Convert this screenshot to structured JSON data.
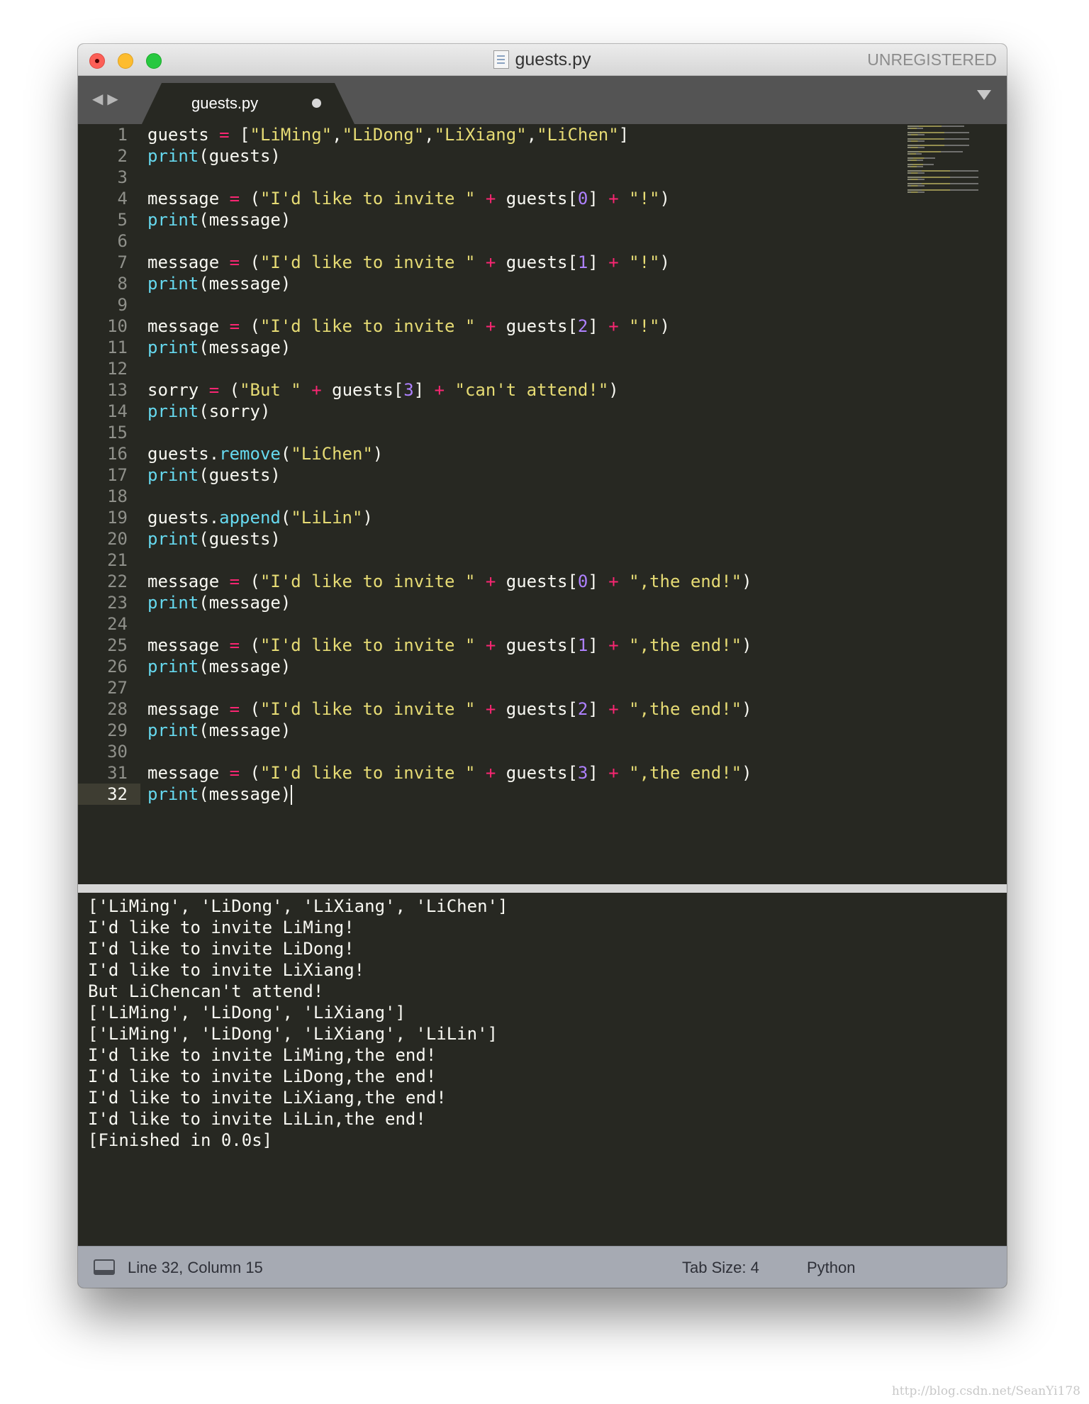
{
  "window": {
    "title": "guests.py",
    "registration": "UNREGISTERED"
  },
  "tab": {
    "label": "guests.py"
  },
  "editor": {
    "current_line": "32",
    "lines": [
      {
        "num": "1",
        "tokens": [
          {
            "t": "guests ",
            "c": ""
          },
          {
            "t": "=",
            "c": "op"
          },
          {
            "t": " [",
            "c": ""
          },
          {
            "t": "\"LiMing\"",
            "c": "str"
          },
          {
            "t": ",",
            "c": ""
          },
          {
            "t": "\"LiDong\"",
            "c": "str"
          },
          {
            "t": ",",
            "c": ""
          },
          {
            "t": "\"LiXiang\"",
            "c": "str"
          },
          {
            "t": ",",
            "c": ""
          },
          {
            "t": "\"LiChen\"",
            "c": "str"
          },
          {
            "t": "]",
            "c": ""
          }
        ]
      },
      {
        "num": "2",
        "tokens": [
          {
            "t": "print",
            "c": "fn"
          },
          {
            "t": "(guests)",
            "c": ""
          }
        ]
      },
      {
        "num": "3",
        "tokens": []
      },
      {
        "num": "4",
        "tokens": [
          {
            "t": "message ",
            "c": ""
          },
          {
            "t": "=",
            "c": "op"
          },
          {
            "t": " (",
            "c": ""
          },
          {
            "t": "\"I'd like to invite \"",
            "c": "str"
          },
          {
            "t": " ",
            "c": ""
          },
          {
            "t": "+",
            "c": "op"
          },
          {
            "t": " guests[",
            "c": ""
          },
          {
            "t": "0",
            "c": "num"
          },
          {
            "t": "] ",
            "c": ""
          },
          {
            "t": "+",
            "c": "op"
          },
          {
            "t": " ",
            "c": ""
          },
          {
            "t": "\"!\"",
            "c": "str"
          },
          {
            "t": ")",
            "c": ""
          }
        ]
      },
      {
        "num": "5",
        "tokens": [
          {
            "t": "print",
            "c": "fn"
          },
          {
            "t": "(message)",
            "c": ""
          }
        ]
      },
      {
        "num": "6",
        "tokens": []
      },
      {
        "num": "7",
        "tokens": [
          {
            "t": "message ",
            "c": ""
          },
          {
            "t": "=",
            "c": "op"
          },
          {
            "t": " (",
            "c": ""
          },
          {
            "t": "\"I'd like to invite \"",
            "c": "str"
          },
          {
            "t": " ",
            "c": ""
          },
          {
            "t": "+",
            "c": "op"
          },
          {
            "t": " guests[",
            "c": ""
          },
          {
            "t": "1",
            "c": "num"
          },
          {
            "t": "] ",
            "c": ""
          },
          {
            "t": "+",
            "c": "op"
          },
          {
            "t": " ",
            "c": ""
          },
          {
            "t": "\"!\"",
            "c": "str"
          },
          {
            "t": ")",
            "c": ""
          }
        ]
      },
      {
        "num": "8",
        "tokens": [
          {
            "t": "print",
            "c": "fn"
          },
          {
            "t": "(message)",
            "c": ""
          }
        ]
      },
      {
        "num": "9",
        "tokens": []
      },
      {
        "num": "10",
        "tokens": [
          {
            "t": "message ",
            "c": ""
          },
          {
            "t": "=",
            "c": "op"
          },
          {
            "t": " (",
            "c": ""
          },
          {
            "t": "\"I'd like to invite \"",
            "c": "str"
          },
          {
            "t": " ",
            "c": ""
          },
          {
            "t": "+",
            "c": "op"
          },
          {
            "t": " guests[",
            "c": ""
          },
          {
            "t": "2",
            "c": "num"
          },
          {
            "t": "] ",
            "c": ""
          },
          {
            "t": "+",
            "c": "op"
          },
          {
            "t": " ",
            "c": ""
          },
          {
            "t": "\"!\"",
            "c": "str"
          },
          {
            "t": ")",
            "c": ""
          }
        ]
      },
      {
        "num": "11",
        "tokens": [
          {
            "t": "print",
            "c": "fn"
          },
          {
            "t": "(message)",
            "c": ""
          }
        ]
      },
      {
        "num": "12",
        "tokens": []
      },
      {
        "num": "13",
        "tokens": [
          {
            "t": "sorry ",
            "c": ""
          },
          {
            "t": "=",
            "c": "op"
          },
          {
            "t": " (",
            "c": ""
          },
          {
            "t": "\"But \"",
            "c": "str"
          },
          {
            "t": " ",
            "c": ""
          },
          {
            "t": "+",
            "c": "op"
          },
          {
            "t": " guests[",
            "c": ""
          },
          {
            "t": "3",
            "c": "num"
          },
          {
            "t": "] ",
            "c": ""
          },
          {
            "t": "+",
            "c": "op"
          },
          {
            "t": " ",
            "c": ""
          },
          {
            "t": "\"can't attend!\"",
            "c": "str"
          },
          {
            "t": ")",
            "c": ""
          }
        ]
      },
      {
        "num": "14",
        "tokens": [
          {
            "t": "print",
            "c": "fn"
          },
          {
            "t": "(sorry)",
            "c": ""
          }
        ]
      },
      {
        "num": "15",
        "tokens": []
      },
      {
        "num": "16",
        "tokens": [
          {
            "t": "guests.",
            "c": ""
          },
          {
            "t": "remove",
            "c": "fn"
          },
          {
            "t": "(",
            "c": ""
          },
          {
            "t": "\"LiChen\"",
            "c": "str"
          },
          {
            "t": ")",
            "c": ""
          }
        ]
      },
      {
        "num": "17",
        "tokens": [
          {
            "t": "print",
            "c": "fn"
          },
          {
            "t": "(guests)",
            "c": ""
          }
        ]
      },
      {
        "num": "18",
        "tokens": []
      },
      {
        "num": "19",
        "tokens": [
          {
            "t": "guests.",
            "c": ""
          },
          {
            "t": "append",
            "c": "fn"
          },
          {
            "t": "(",
            "c": ""
          },
          {
            "t": "\"LiLin\"",
            "c": "str"
          },
          {
            "t": ")",
            "c": ""
          }
        ]
      },
      {
        "num": "20",
        "tokens": [
          {
            "t": "print",
            "c": "fn"
          },
          {
            "t": "(guests)",
            "c": ""
          }
        ]
      },
      {
        "num": "21",
        "tokens": []
      },
      {
        "num": "22",
        "tokens": [
          {
            "t": "message ",
            "c": ""
          },
          {
            "t": "=",
            "c": "op"
          },
          {
            "t": " (",
            "c": ""
          },
          {
            "t": "\"I'd like to invite \"",
            "c": "str"
          },
          {
            "t": " ",
            "c": ""
          },
          {
            "t": "+",
            "c": "op"
          },
          {
            "t": " guests[",
            "c": ""
          },
          {
            "t": "0",
            "c": "num"
          },
          {
            "t": "] ",
            "c": ""
          },
          {
            "t": "+",
            "c": "op"
          },
          {
            "t": " ",
            "c": ""
          },
          {
            "t": "\",the end!\"",
            "c": "str"
          },
          {
            "t": ")",
            "c": ""
          }
        ]
      },
      {
        "num": "23",
        "tokens": [
          {
            "t": "print",
            "c": "fn"
          },
          {
            "t": "(message)",
            "c": ""
          }
        ]
      },
      {
        "num": "24",
        "tokens": []
      },
      {
        "num": "25",
        "tokens": [
          {
            "t": "message ",
            "c": ""
          },
          {
            "t": "=",
            "c": "op"
          },
          {
            "t": " (",
            "c": ""
          },
          {
            "t": "\"I'd like to invite \"",
            "c": "str"
          },
          {
            "t": " ",
            "c": ""
          },
          {
            "t": "+",
            "c": "op"
          },
          {
            "t": " guests[",
            "c": ""
          },
          {
            "t": "1",
            "c": "num"
          },
          {
            "t": "] ",
            "c": ""
          },
          {
            "t": "+",
            "c": "op"
          },
          {
            "t": " ",
            "c": ""
          },
          {
            "t": "\",the end!\"",
            "c": "str"
          },
          {
            "t": ")",
            "c": ""
          }
        ]
      },
      {
        "num": "26",
        "tokens": [
          {
            "t": "print",
            "c": "fn"
          },
          {
            "t": "(message)",
            "c": ""
          }
        ]
      },
      {
        "num": "27",
        "tokens": []
      },
      {
        "num": "28",
        "tokens": [
          {
            "t": "message ",
            "c": ""
          },
          {
            "t": "=",
            "c": "op"
          },
          {
            "t": " (",
            "c": ""
          },
          {
            "t": "\"I'd like to invite \"",
            "c": "str"
          },
          {
            "t": " ",
            "c": ""
          },
          {
            "t": "+",
            "c": "op"
          },
          {
            "t": " guests[",
            "c": ""
          },
          {
            "t": "2",
            "c": "num"
          },
          {
            "t": "] ",
            "c": ""
          },
          {
            "t": "+",
            "c": "op"
          },
          {
            "t": " ",
            "c": ""
          },
          {
            "t": "\",the end!\"",
            "c": "str"
          },
          {
            "t": ")",
            "c": ""
          }
        ]
      },
      {
        "num": "29",
        "tokens": [
          {
            "t": "print",
            "c": "fn"
          },
          {
            "t": "(message)",
            "c": ""
          }
        ]
      },
      {
        "num": "30",
        "tokens": []
      },
      {
        "num": "31",
        "tokens": [
          {
            "t": "message ",
            "c": ""
          },
          {
            "t": "=",
            "c": "op"
          },
          {
            "t": " (",
            "c": ""
          },
          {
            "t": "\"I'd like to invite \"",
            "c": "str"
          },
          {
            "t": " ",
            "c": ""
          },
          {
            "t": "+",
            "c": "op"
          },
          {
            "t": " guests[",
            "c": ""
          },
          {
            "t": "3",
            "c": "num"
          },
          {
            "t": "] ",
            "c": ""
          },
          {
            "t": "+",
            "c": "op"
          },
          {
            "t": " ",
            "c": ""
          },
          {
            "t": "\",the end!\"",
            "c": "str"
          },
          {
            "t": ")",
            "c": ""
          }
        ]
      },
      {
        "num": "32",
        "tokens": [
          {
            "t": "print",
            "c": "fn"
          },
          {
            "t": "(message)",
            "c": ""
          }
        ]
      }
    ]
  },
  "output": {
    "lines": [
      "['LiMing', 'LiDong', 'LiXiang', 'LiChen']",
      "I'd like to invite LiMing!",
      "I'd like to invite LiDong!",
      "I'd like to invite LiXiang!",
      "But LiChencan't attend!",
      "['LiMing', 'LiDong', 'LiXiang']",
      "['LiMing', 'LiDong', 'LiXiang', 'LiLin']",
      "I'd like to invite LiMing,the end!",
      "I'd like to invite LiDong,the end!",
      "I'd like to invite LiXiang,the end!",
      "I'd like to invite LiLin,the end!",
      "[Finished in 0.0s]"
    ]
  },
  "status": {
    "position": "Line 32, Column 15",
    "tab_size": "Tab Size: 4",
    "syntax": "Python"
  },
  "watermark": "http://blog.csdn.net/SeanYi178"
}
